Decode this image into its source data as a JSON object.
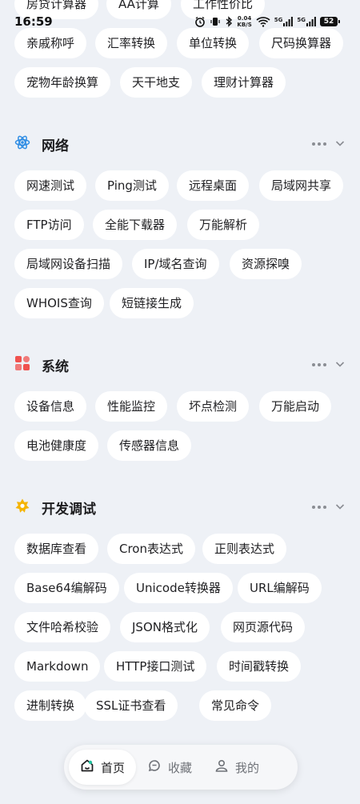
{
  "status_bar": {
    "time": "16:59",
    "net_speed_value": "0.04",
    "net_speed_unit": "KB/S",
    "signal1": "5G",
    "signal2": "5G",
    "battery": "52"
  },
  "top_partial_row": [
    "房贷计算器",
    "AA计算",
    "工作性价比"
  ],
  "life_rows": [
    [
      "亲戚称呼",
      "汇率转换",
      "单位转换",
      "尺码换算器"
    ],
    [
      "宠物年龄换算",
      "天干地支",
      "理财计算器"
    ]
  ],
  "sections": {
    "network": {
      "title": "网络",
      "items": [
        "网速测试",
        "Ping测试",
        "远程桌面",
        "局域网共享",
        "FTP访问",
        "全能下载器",
        "万能解析",
        "局域网设备扫描",
        "IP/域名查询",
        "资源探嗅",
        "WHOIS查询",
        "短链接生成"
      ]
    },
    "system": {
      "title": "系统",
      "items": [
        "设备信息",
        "性能监控",
        "坏点检测",
        "万能启动",
        "电池健康度",
        "传感器信息"
      ]
    },
    "dev": {
      "title": "开发调试",
      "items": [
        "数据库查看",
        "Cron表达式",
        "正则表达式",
        "Base64编解码",
        "Unicode转换器",
        "URL编解码",
        "文件哈希校验",
        "JSON格式化",
        "网页源代码",
        "Markdown",
        "HTTP接口测试",
        "时间戳转换",
        "进制转换",
        "SSL证书查看",
        "常见命令"
      ]
    }
  },
  "bottom_nav": {
    "home": "首页",
    "favorites": "收藏",
    "mine": "我的"
  },
  "colors": {
    "background": "#eef1f6",
    "chip": "#ffffff",
    "network_icon": "#2f8de4",
    "system_icon": "#f0524f",
    "dev_icon": "#f5b400"
  }
}
